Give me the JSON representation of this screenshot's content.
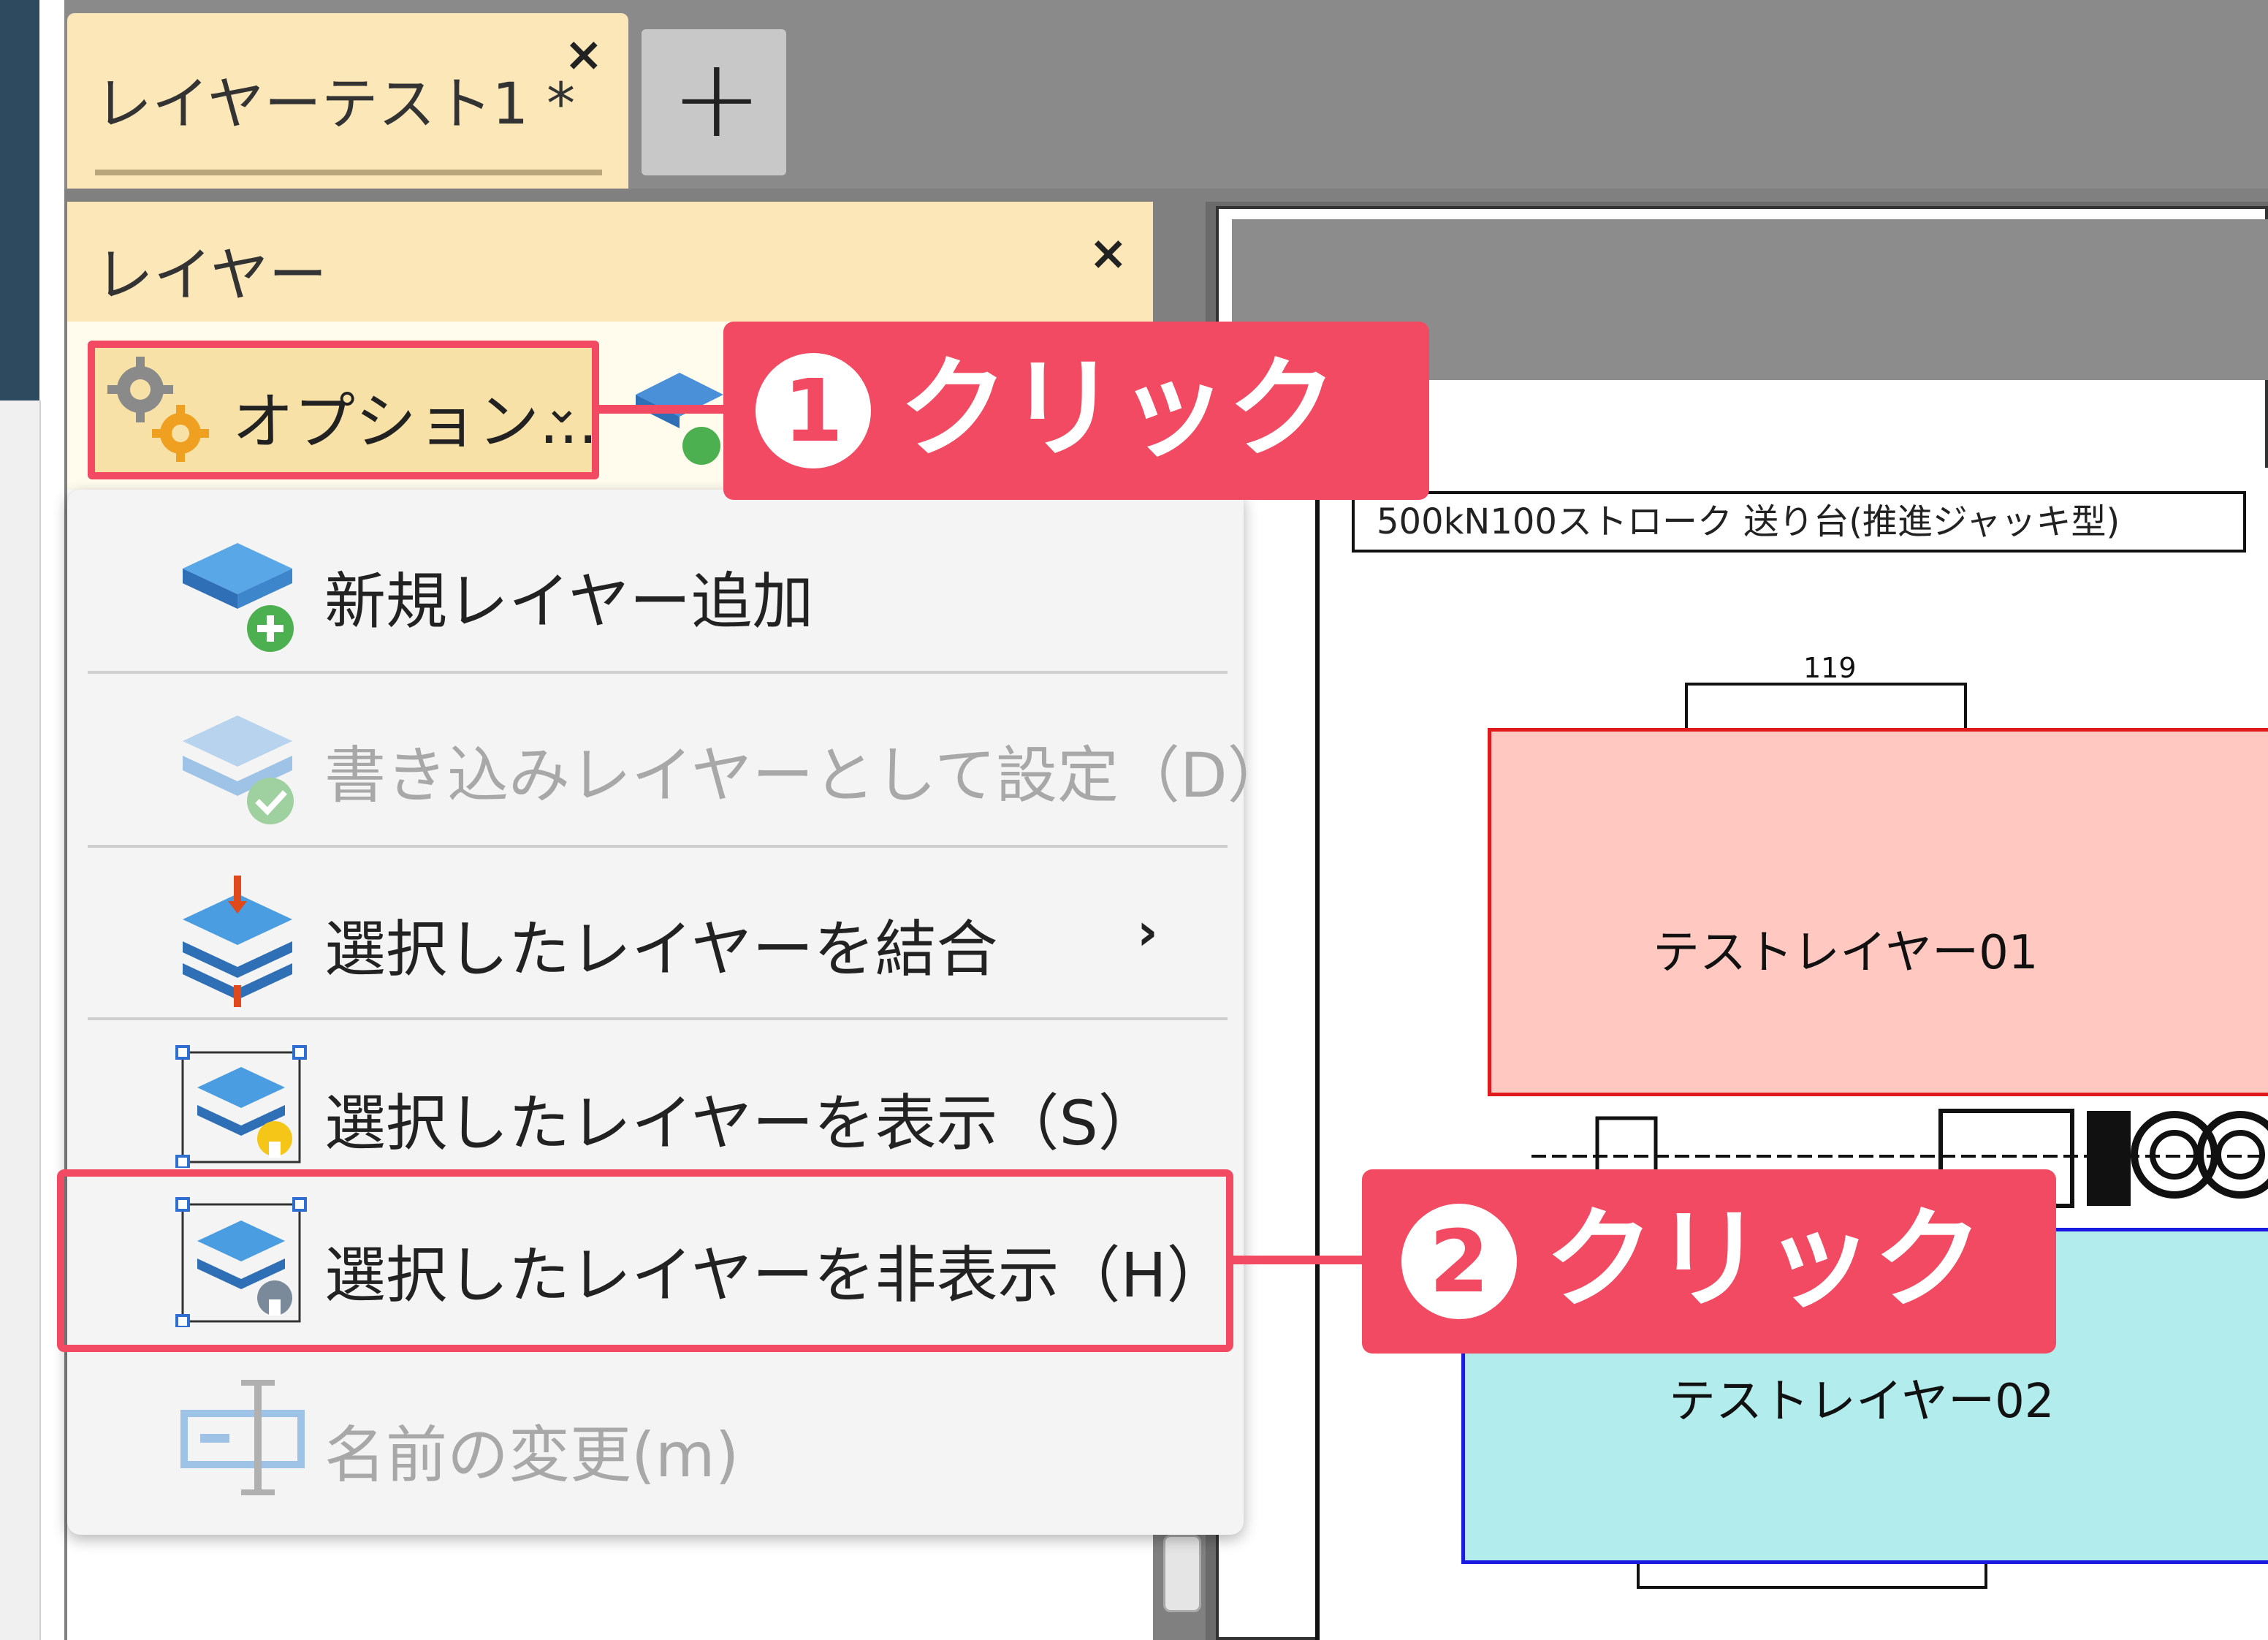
{
  "document_tab": {
    "label": "レイヤーテスト1 *",
    "close": "×",
    "add": "+"
  },
  "layer_panel": {
    "title": "レイヤー",
    "close": "×"
  },
  "options_button": {
    "label": "オプション...",
    "chevron": "⌄"
  },
  "menu": {
    "items": [
      {
        "label": "新規レイヤー追加",
        "enabled": true,
        "icon": "layer-add-icon"
      },
      {
        "label": "書き込みレイヤーとして設定（D）",
        "enabled": false,
        "icon": "layer-check-icon"
      },
      {
        "label": "選択したレイヤーを結合",
        "enabled": true,
        "icon": "layer-merge-icon",
        "submenu_arrow": "›"
      },
      {
        "label": "選択したレイヤーを表示（S）",
        "enabled": true,
        "icon": "layer-show-icon"
      },
      {
        "label": "選択したレイヤーを非表示（H）",
        "enabled": true,
        "icon": "layer-hide-icon",
        "highlighted": true
      },
      {
        "label": "名前の変更(m)",
        "enabled": false,
        "icon": "rename-icon"
      }
    ]
  },
  "callouts": [
    {
      "number": "1",
      "text": "クリック"
    },
    {
      "number": "2",
      "text": "クリック"
    }
  ],
  "drawing": {
    "title": "500kN100ストローク 送り台(推進ジャッキ型)",
    "dimension": "119",
    "layer01_label": "テストレイヤー01",
    "layer02_label": "テストレイヤー02"
  },
  "colors": {
    "accent": "#f24a63",
    "tab_bg": "#fbe7b8",
    "layer01_fill": "#ffc8c0",
    "layer01_border": "#e0191c",
    "layer02_fill": "#b2ecec",
    "layer02_border": "#1a1ae0"
  }
}
